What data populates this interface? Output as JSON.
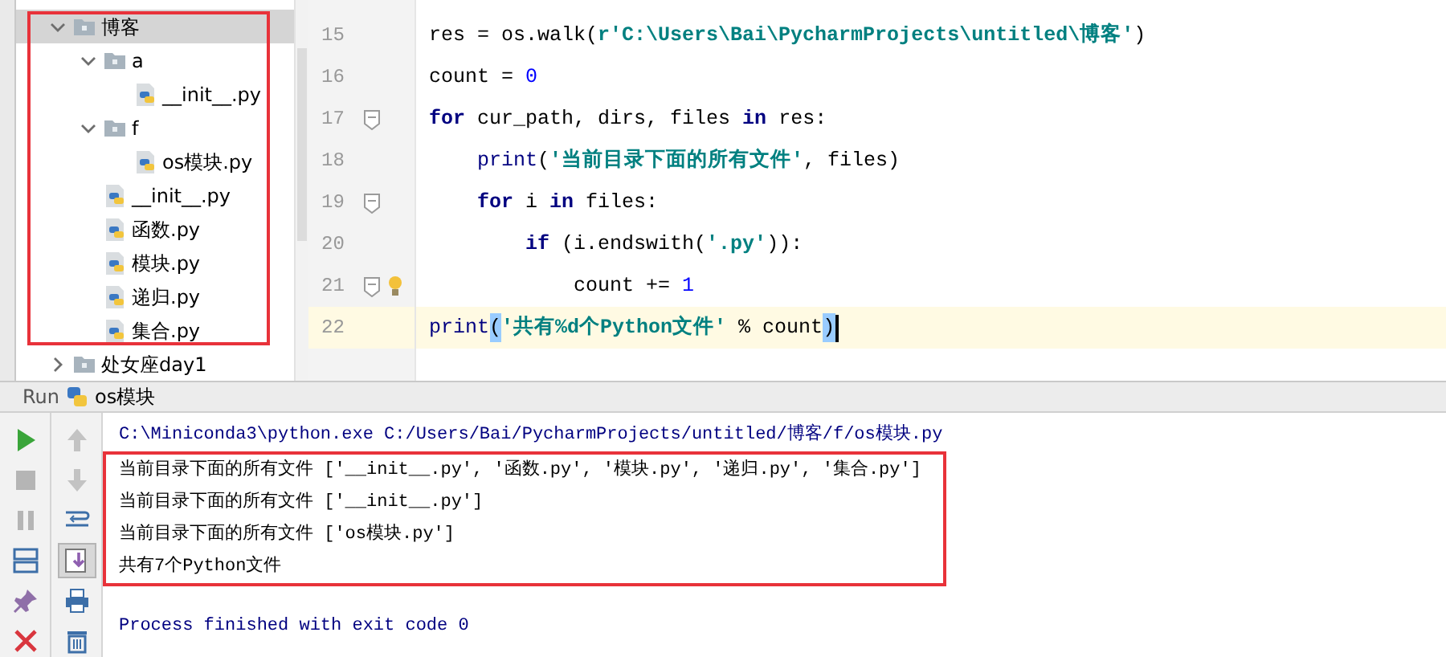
{
  "project_tree": [
    {
      "kind": "folder",
      "label": "博客",
      "expanded": true,
      "selected": true,
      "children": [
        {
          "kind": "folder",
          "label": "a",
          "expanded": true,
          "selected": false,
          "children": [
            {
              "kind": "file",
              "label": "__init__.py",
              "selected": false
            }
          ]
        },
        {
          "kind": "folder",
          "label": "f",
          "expanded": true,
          "selected": false,
          "children": [
            {
              "kind": "file",
              "label": "os模块.py",
              "selected": false
            }
          ]
        },
        {
          "kind": "file",
          "label": "__init__.py",
          "selected": false
        },
        {
          "kind": "file",
          "label": "函数.py",
          "selected": false
        },
        {
          "kind": "file",
          "label": "模块.py",
          "selected": false
        },
        {
          "kind": "file",
          "label": "递归.py",
          "selected": false
        },
        {
          "kind": "file",
          "label": "集合.py",
          "selected": false
        }
      ]
    },
    {
      "kind": "folder",
      "label": "处女座day1",
      "expanded": false,
      "selected": false
    }
  ],
  "editor": {
    "lines": [
      {
        "number": "15",
        "current": false,
        "fold_marker": false,
        "intention": false,
        "tokens": [
          {
            "kind": "plain",
            "text": "res = os.walk("
          },
          {
            "kind": "string",
            "text": "r'C:\\Users\\Bai\\PycharmProjects\\untitled\\博客'"
          },
          {
            "kind": "plain",
            "text": ")"
          }
        ]
      },
      {
        "number": "16",
        "current": false,
        "fold_marker": false,
        "intention": false,
        "tokens": [
          {
            "kind": "plain",
            "text": "count = "
          },
          {
            "kind": "number",
            "text": "0"
          }
        ]
      },
      {
        "number": "17",
        "current": false,
        "fold_marker": true,
        "intention": false,
        "tokens": [
          {
            "kind": "keyword",
            "text": "for"
          },
          {
            "kind": "plain",
            "text": " cur_path, dirs, files "
          },
          {
            "kind": "keyword",
            "text": "in"
          },
          {
            "kind": "plain",
            "text": " res:"
          }
        ]
      },
      {
        "number": "18",
        "current": false,
        "fold_marker": false,
        "intention": false,
        "tokens": [
          {
            "kind": "builtin",
            "text": "    print"
          },
          {
            "kind": "plain",
            "text": "("
          },
          {
            "kind": "string",
            "text": "'当前目录下面的所有文件'"
          },
          {
            "kind": "plain",
            "text": ", files)"
          }
        ]
      },
      {
        "number": "19",
        "current": false,
        "fold_marker": true,
        "intention": false,
        "tokens": [
          {
            "kind": "keyword",
            "text": "    for"
          },
          {
            "kind": "plain",
            "text": " i "
          },
          {
            "kind": "keyword",
            "text": "in"
          },
          {
            "kind": "plain",
            "text": " files:"
          }
        ]
      },
      {
        "number": "20",
        "current": false,
        "fold_marker": false,
        "intention": false,
        "tokens": [
          {
            "kind": "keyword",
            "text": "        if"
          },
          {
            "kind": "plain",
            "text": " (i.endswith("
          },
          {
            "kind": "string",
            "text": "'.py'"
          },
          {
            "kind": "plain",
            "text": ")):"
          }
        ]
      },
      {
        "number": "21",
        "current": false,
        "fold_marker": true,
        "intention": true,
        "tokens": [
          {
            "kind": "plain",
            "text": "            count += "
          },
          {
            "kind": "number",
            "text": "1"
          }
        ]
      },
      {
        "number": "22",
        "current": true,
        "fold_marker": false,
        "intention": false,
        "tokens": [
          {
            "kind": "builtin",
            "text": "print"
          },
          {
            "kind": "bracket",
            "text": "("
          },
          {
            "kind": "string",
            "text": "'共有%d个Python文件'"
          },
          {
            "kind": "plain",
            "text": " % count"
          },
          {
            "kind": "bracket",
            "text": ")"
          }
        ]
      }
    ]
  },
  "run_panel": {
    "label": "Run",
    "config": "os模块",
    "console": [
      {
        "kind": "command",
        "text": "C:\\Miniconda3\\python.exe C:/Users/Bai/PycharmProjects/untitled/博客/f/os模块.py"
      },
      {
        "kind": "output",
        "text": "当前目录下面的所有文件 ['__init__.py', '函数.py', '模块.py', '递归.py', '集合.py']"
      },
      {
        "kind": "output",
        "text": "当前目录下面的所有文件 ['__init__.py']"
      },
      {
        "kind": "output",
        "text": "当前目录下面的所有文件 ['os模块.py']"
      },
      {
        "kind": "output",
        "text": "共有7个Python文件"
      },
      {
        "kind": "exit",
        "text": "Process finished with exit code 0"
      }
    ]
  }
}
